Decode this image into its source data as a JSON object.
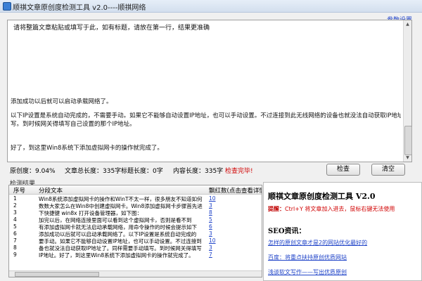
{
  "window": {
    "title": "顺祺文章原创度检测工具  v2.0----顺祺网络",
    "settings_link": "参数设置"
  },
  "editor": {
    "hint": "请将整篇文章粘贴或填写于此，如有标题，请放在第一行，结果更准确",
    "lines": [
      "添加成功以后就可以启动承载网络了。",
      "以下IP设置是系统自动完成的，不需要手动。如果它不能够自动设置IP地址，也可以手动设置。不过连接到此无线网络的设备也就没法自动获取IP地址了。同样需要手动填",
      "写。到时候网关得填写自己设置的那个IP地址。",
      "好了，到这里Win8系统下添加虚拟网卡的操作就完成了。"
    ]
  },
  "stats": {
    "originality": "原创度：9.04%",
    "total_length": "文章总长度：335字",
    "title_length": "标题长度：0字",
    "content_length": "内容长度：335字",
    "status": "检查完毕!"
  },
  "buttons": {
    "check": "检查",
    "clear": "清空"
  },
  "results": {
    "section_label": "检测结果",
    "columns": [
      "序号",
      "分段文本",
      "飘红数(点击查看详情)"
    ],
    "rows": [
      {
        "no": "1",
        "text": "Win8系统添加虚拟网卡的操作和WinT不太一样，很多朋友不知道如何",
        "count": "10"
      },
      {
        "no": "2",
        "text": "数数大家怎么在Win8中创建虚拟网卡。Win8添加虚拟网卡步骤首先进",
        "count": "3"
      },
      {
        "no": "3",
        "text": "下快捷键 win8x 打开设备管理器，如下图：",
        "count": "8"
      },
      {
        "no": "4",
        "text": "加完以后，在网络连接里面可以看到这个虚拟网卡，否则是看不到",
        "count": "5"
      },
      {
        "no": "5",
        "text": "有添加虚拟网卡就无法启动承载网络，用命令操作的时候会提示如下",
        "count": "6"
      },
      {
        "no": "6",
        "text": "添加成功以后就可以启动承载网络了。以下IP设置是系统自动完成的",
        "count": "3"
      },
      {
        "no": "7",
        "text": "要手动。如果它不能够自动设置IP地址，也可以手动设置。不过连接到",
        "count": "10"
      },
      {
        "no": "8",
        "text": "备也就没法自动获取IP地址了。同样需要手动填写。到时候网关得填写",
        "count": "3"
      },
      {
        "no": "9",
        "text": "IP地址。好了，到这里Win8系统下添加虚拟网卡的操作就完成了。",
        "count": "7"
      }
    ]
  },
  "side": {
    "title": "顺祺文章原创度检测工具 V2.0",
    "tip_prefix": "提醒：",
    "tip_text": "Ctrl+Y 将文章加入进去，鼠标右键无法使用",
    "seo_label": "SEO资讯：",
    "links": [
      "怎样的原创文章才是2的网站优化最好的",
      "百度：将重点扶持原创优质网站",
      "浅谈软文写作——写出优质原创"
    ]
  }
}
